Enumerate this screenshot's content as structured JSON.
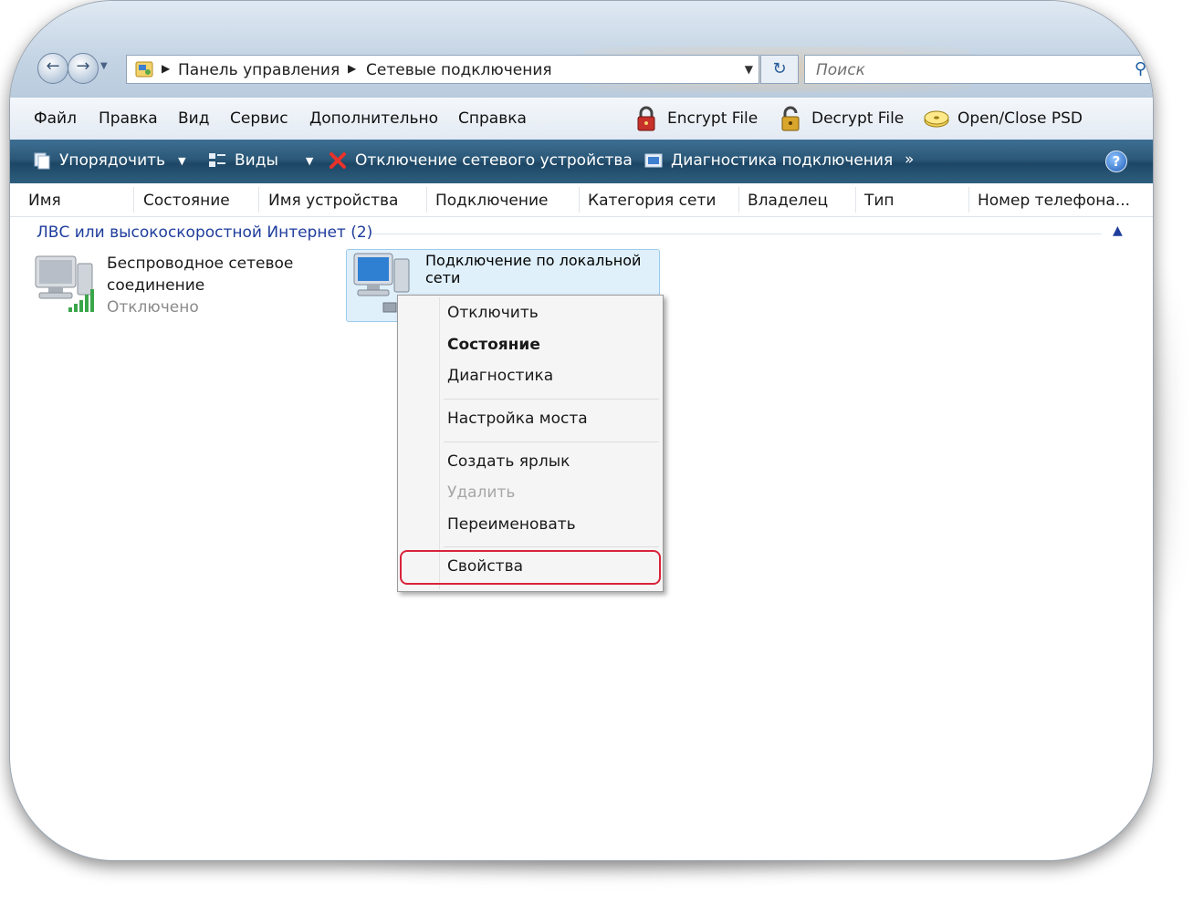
{
  "address": {
    "crumbs": [
      "Панель управления",
      "Сетевые подключения"
    ],
    "search_placeholder": "Поиск"
  },
  "menubar": {
    "items": [
      "Файл",
      "Правка",
      "Вид",
      "Сервис",
      "Дополнительно",
      "Справка"
    ],
    "tools": [
      "Encrypt File",
      "Decrypt File",
      "Open/Close PSD"
    ]
  },
  "commandbar": {
    "organize": "Упорядочить",
    "views": "Виды",
    "disable": "Отключение сетевого устройства",
    "diagnose": "Диагностика подключения",
    "more": "»",
    "help": "?"
  },
  "columns": [
    "Имя",
    "Состояние",
    "Имя устройства",
    "Подключение",
    "Категория сети",
    "Владелец",
    "Тип",
    "Номер телефона..."
  ],
  "group": {
    "title": "ЛВС или высокоскоростной Интернет (2)"
  },
  "items": [
    {
      "name_line1": "Беспроводное сетевое",
      "name_line2": "соединение",
      "status": "Отключено"
    },
    {
      "name_line1": "Подключение по локальной",
      "name_line2": "сети"
    }
  ],
  "context_menu": {
    "disable": "Отключить",
    "status": "Состояние",
    "diagnostics": "Диагностика",
    "bridge": "Настройка моста",
    "shortcut": "Создать ярлык",
    "delete": "Удалить",
    "rename": "Переименовать",
    "properties": "Свойства"
  },
  "colors": {
    "command_bar": "#2b5878",
    "group_text": "#1e3d9c",
    "highlight_ring": "#d9233a",
    "selection": "#dff0fb"
  }
}
